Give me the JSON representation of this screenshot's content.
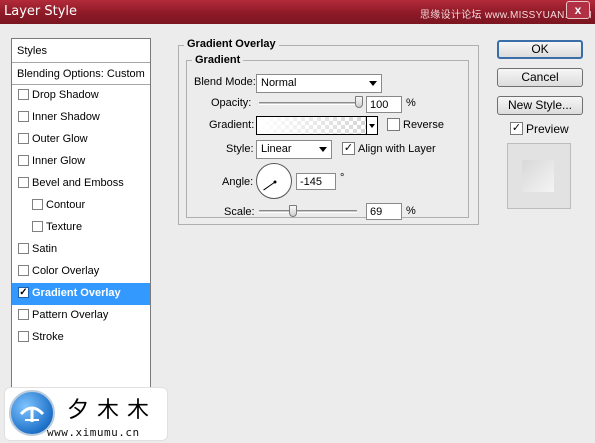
{
  "window": {
    "title": "Layer Style",
    "watermark": "思缘设计论坛 www.MISSYUAN.COM",
    "close_glyph": "x"
  },
  "styles_panel": {
    "header": "Styles",
    "blending_options": "Blending Options: Custom",
    "items": [
      {
        "label": "Drop Shadow",
        "checked": false
      },
      {
        "label": "Inner Shadow",
        "checked": false
      },
      {
        "label": "Outer Glow",
        "checked": false
      },
      {
        "label": "Inner Glow",
        "checked": false
      },
      {
        "label": "Bevel and Emboss",
        "checked": false
      },
      {
        "label": "Contour",
        "checked": false
      },
      {
        "label": "Texture",
        "checked": false
      },
      {
        "label": "Satin",
        "checked": false
      },
      {
        "label": "Color Overlay",
        "checked": false
      },
      {
        "label": "Gradient Overlay",
        "checked": true
      },
      {
        "label": "Pattern Overlay",
        "checked": false
      },
      {
        "label": "Stroke",
        "checked": false
      }
    ]
  },
  "gradient_overlay": {
    "group_title": "Gradient Overlay",
    "sub_title": "Gradient",
    "blend_mode_label": "Blend Mode:",
    "blend_mode_value": "Normal",
    "opacity_label": "Opacity:",
    "opacity_value": "100",
    "opacity_level": 1.0,
    "percent": "%",
    "gradient_label": "Gradient:",
    "reverse_label": "Reverse",
    "reverse_checked": false,
    "style_label": "Style:",
    "style_value": "Linear",
    "align_label": "Align with Layer",
    "align_checked": true,
    "angle_label": "Angle:",
    "angle_value": "-145",
    "degree": "°",
    "scale_label": "Scale:",
    "scale_value": "69",
    "scale_level": 0.345
  },
  "buttons": {
    "ok": "OK",
    "cancel": "Cancel",
    "new_style": "New Style...",
    "preview_label": "Preview",
    "preview_checked": true
  },
  "logo": {
    "name": "夕木木",
    "url": "www.ximumu.cn"
  },
  "colors": {
    "title_bar": "#8d1a27",
    "selection": "#3399ff",
    "default_button_border": "#3a6ea8"
  },
  "checkmark": "✓"
}
